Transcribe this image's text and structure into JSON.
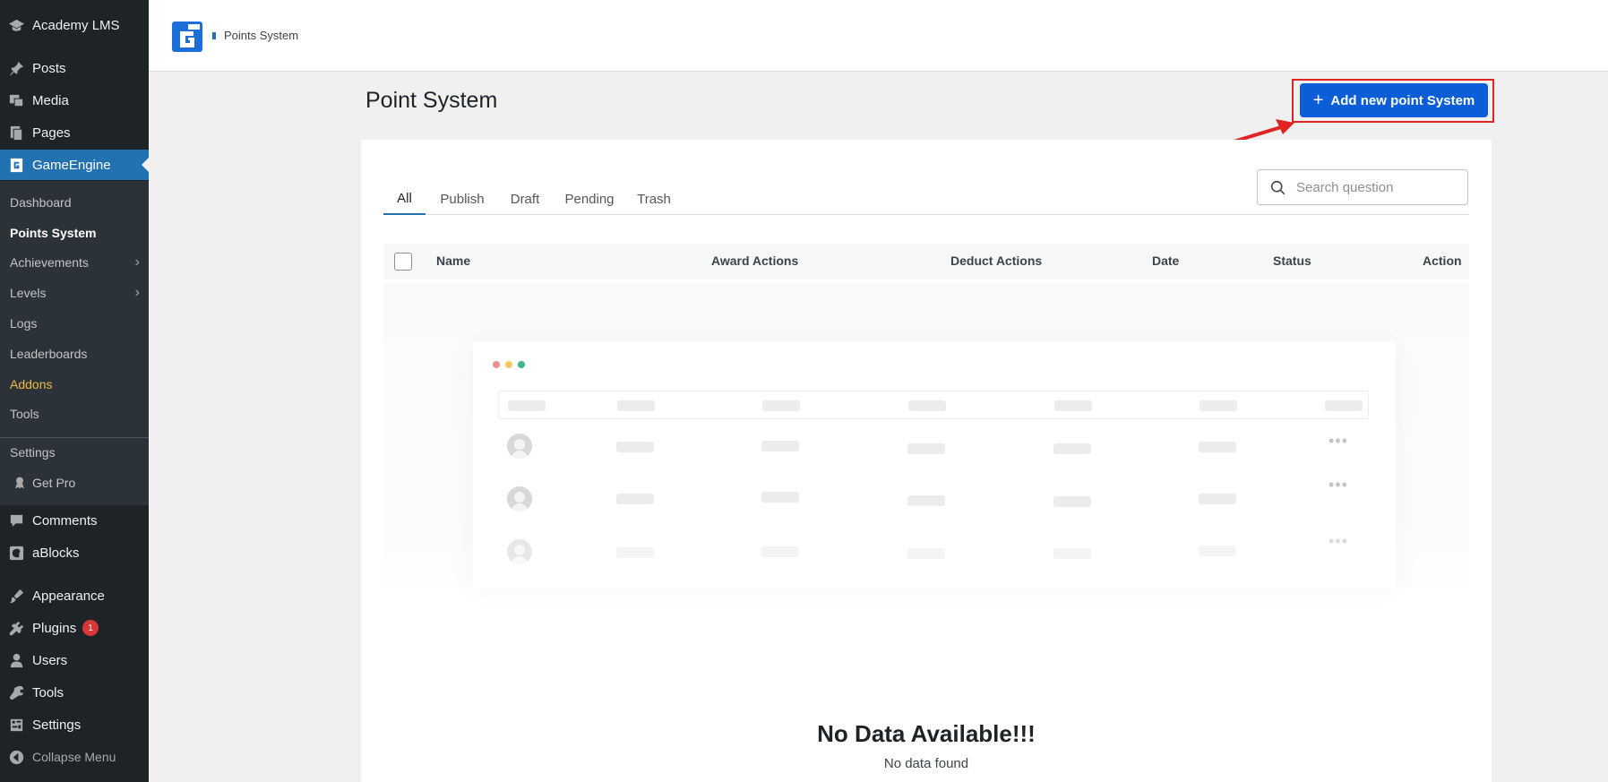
{
  "sidebar": {
    "items": [
      {
        "label": "Academy LMS",
        "icon": "academy-icon"
      },
      {
        "label": "Posts",
        "icon": "pin-icon"
      },
      {
        "label": "Media",
        "icon": "media-icon"
      },
      {
        "label": "Pages",
        "icon": "pages-icon"
      },
      {
        "label": "GameEngine",
        "icon": "gameengine-icon"
      },
      {
        "label": "Comments",
        "icon": "comment-icon"
      },
      {
        "label": "aBlocks",
        "icon": "ablocks-icon"
      },
      {
        "label": "Appearance",
        "icon": "brush-icon"
      },
      {
        "label": "Plugins",
        "icon": "plug-icon",
        "badge": "1"
      },
      {
        "label": "Users",
        "icon": "user-icon"
      },
      {
        "label": "Tools",
        "icon": "wrench-icon"
      },
      {
        "label": "Settings",
        "icon": "settings-icon"
      },
      {
        "label": "Collapse Menu",
        "icon": "collapse-icon"
      }
    ],
    "submenu": [
      {
        "label": "Dashboard"
      },
      {
        "label": "Points System"
      },
      {
        "label": "Achievements",
        "chevron": "›"
      },
      {
        "label": "Levels",
        "chevron": "›"
      },
      {
        "label": "Logs"
      },
      {
        "label": "Leaderboards"
      },
      {
        "label": "Addons"
      },
      {
        "label": "Tools"
      },
      {
        "label": "Settings"
      },
      {
        "label": "Get Pro",
        "icon": "award-icon"
      }
    ]
  },
  "header": {
    "breadcrumb": "Points System"
  },
  "main": {
    "title": "Point System",
    "add_button": {
      "plus": "+",
      "label": "Add new point System"
    },
    "tabs": [
      "All",
      "Publish",
      "Draft",
      "Pending",
      "Trash"
    ],
    "search": {
      "placeholder": "Search question"
    },
    "table": {
      "headers": [
        "Name",
        "Award Actions",
        "Deduct Actions",
        "Date",
        "Status",
        "Action"
      ],
      "more": "•••"
    },
    "empty": {
      "title": "No Data Available!!!",
      "subtitle": "No data found"
    }
  },
  "colors": {
    "sidebar_bg": "#1d2327",
    "submenu_bg": "#2c3338",
    "wp_blue": "#2271b1",
    "button_blue": "#0b5ed7",
    "highlight_red": "#e02424",
    "addons_yellow": "#f0b849"
  }
}
